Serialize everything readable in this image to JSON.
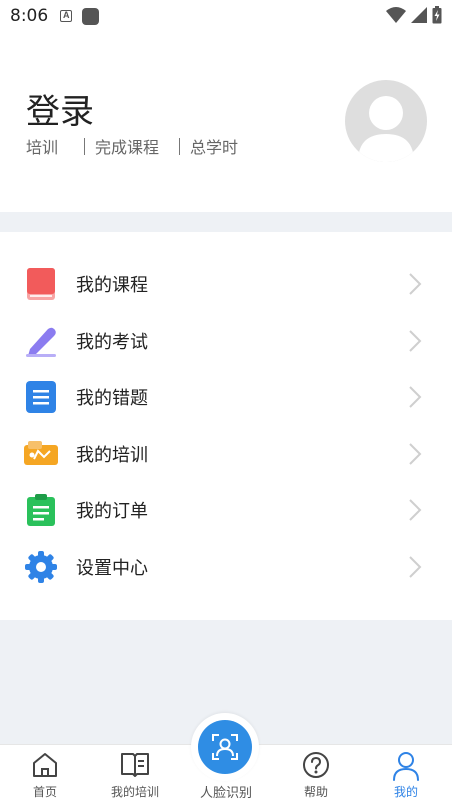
{
  "status_bar": {
    "time": "8:06",
    "a_glyph": "A"
  },
  "header": {
    "login": "登录",
    "stats": [
      "培训",
      "完成课程",
      "总学时"
    ]
  },
  "menu": {
    "items": [
      {
        "label": "我的课程",
        "icon": "book-icon",
        "color": "#f25b5b"
      },
      {
        "label": "我的考试",
        "icon": "pencil-icon",
        "color": "#8b7cf0"
      },
      {
        "label": "我的错题",
        "icon": "list-icon",
        "color": "#2f83e6"
      },
      {
        "label": "我的培训",
        "icon": "ticket-icon",
        "color": "#f5a623"
      },
      {
        "label": "我的订单",
        "icon": "clipboard-icon",
        "color": "#2ac15b"
      },
      {
        "label": "设置中心",
        "icon": "gear-icon",
        "color": "#2f83e6"
      }
    ]
  },
  "tabbar": {
    "tabs": [
      {
        "label": "首页",
        "icon": "home-icon"
      },
      {
        "label": "我的培训",
        "icon": "open-book-icon"
      },
      {
        "label": "人脸识别",
        "icon": "face-scan-icon"
      },
      {
        "label": "帮助",
        "icon": "help-icon"
      },
      {
        "label": "我的",
        "icon": "person-icon"
      }
    ],
    "active_color": "#2f83e6"
  }
}
